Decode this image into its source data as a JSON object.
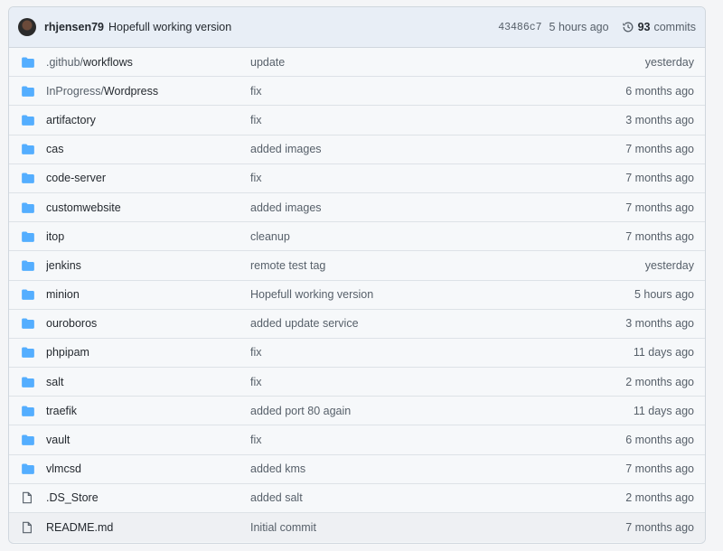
{
  "header": {
    "author": "rhjensen79",
    "message": "Hopefull working version",
    "sha": "43486c7",
    "time": "5 hours ago",
    "commits_count": "93",
    "commits_label": "commits"
  },
  "files": [
    {
      "type": "folder",
      "prefix": ".github/",
      "name": "workflows",
      "message": "update",
      "age": "yesterday"
    },
    {
      "type": "folder",
      "prefix": "InProgress/",
      "name": "Wordpress",
      "message": "fix",
      "age": "6 months ago"
    },
    {
      "type": "folder",
      "prefix": "",
      "name": "artifactory",
      "message": "fix",
      "age": "3 months ago"
    },
    {
      "type": "folder",
      "prefix": "",
      "name": "cas",
      "message": "added images",
      "age": "7 months ago"
    },
    {
      "type": "folder",
      "prefix": "",
      "name": "code-server",
      "message": "fix",
      "age": "7 months ago"
    },
    {
      "type": "folder",
      "prefix": "",
      "name": "customwebsite",
      "message": "added images",
      "age": "7 months ago"
    },
    {
      "type": "folder",
      "prefix": "",
      "name": "itop",
      "message": "cleanup",
      "age": "7 months ago"
    },
    {
      "type": "folder",
      "prefix": "",
      "name": "jenkins",
      "message": "remote test tag",
      "age": "yesterday"
    },
    {
      "type": "folder",
      "prefix": "",
      "name": "minion",
      "message": "Hopefull working version",
      "age": "5 hours ago"
    },
    {
      "type": "folder",
      "prefix": "",
      "name": "ouroboros",
      "message": "added update service",
      "age": "3 months ago"
    },
    {
      "type": "folder",
      "prefix": "",
      "name": "phpipam",
      "message": "fix",
      "age": "11 days ago"
    },
    {
      "type": "folder",
      "prefix": "",
      "name": "salt",
      "message": "fix",
      "age": "2 months ago"
    },
    {
      "type": "folder",
      "prefix": "",
      "name": "traefik",
      "message": "added port 80 again",
      "age": "11 days ago"
    },
    {
      "type": "folder",
      "prefix": "",
      "name": "vault",
      "message": "fix",
      "age": "6 months ago"
    },
    {
      "type": "folder",
      "prefix": "",
      "name": "vlmcsd",
      "message": "added kms",
      "age": "7 months ago"
    },
    {
      "type": "file",
      "prefix": "",
      "name": ".DS_Store",
      "message": "added salt",
      "age": "2 months ago"
    },
    {
      "type": "file",
      "prefix": "",
      "name": "README.md",
      "message": "Initial commit",
      "age": "7 months ago"
    }
  ],
  "colors": {
    "folder": "#54aeff",
    "file": "#57606a",
    "header_bg": "#e8eef6"
  }
}
